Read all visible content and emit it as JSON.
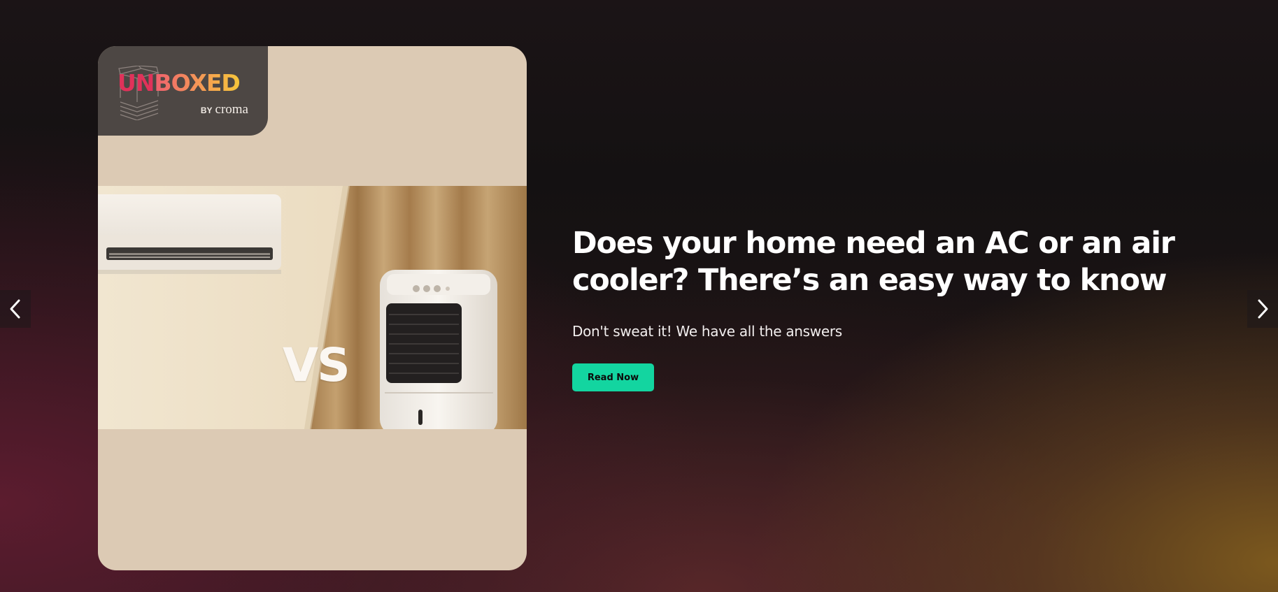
{
  "slide": {
    "headline": "Does your home need an AC or an air cooler? There’s an easy way to know",
    "subtitle": "Don't sweat it! We have all the answers",
    "cta_label": "Read Now"
  },
  "brand": {
    "logo_un": "UN",
    "logo_boxed": "BOXED",
    "logo_by": "BY",
    "logo_croma": "croma"
  },
  "image": {
    "vs_label": "VS"
  },
  "navigation": {
    "prev_icon": "chevron-left-icon",
    "next_icon": "chevron-right-icon"
  },
  "colors": {
    "cta_background": "#13d5a0",
    "card_background": "#dccab4",
    "logo_background": "#4d4744"
  }
}
